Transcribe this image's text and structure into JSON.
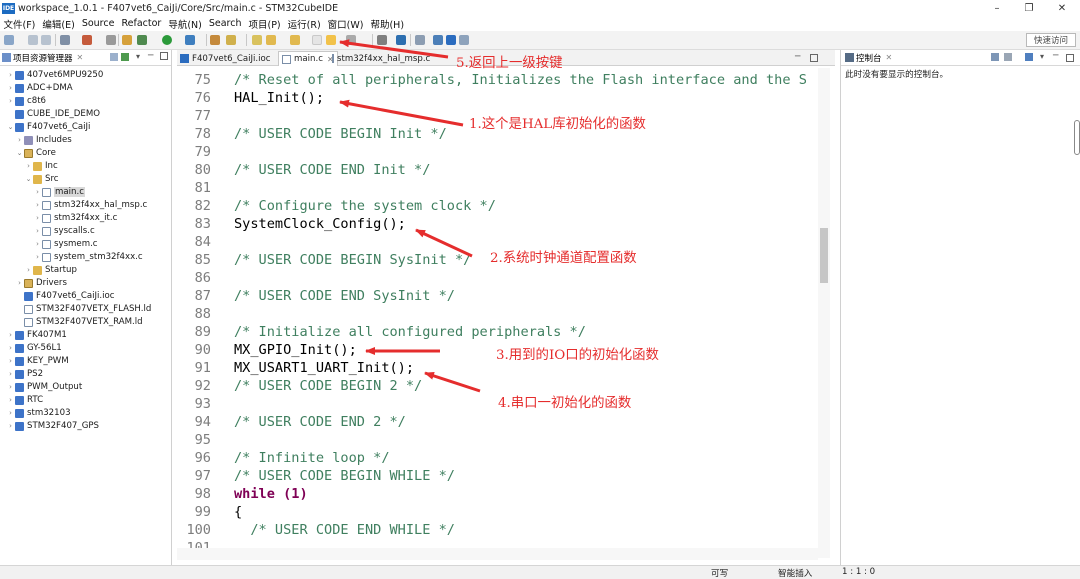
{
  "window": {
    "title": "workspace_1.0.1 - F407vet6_CaiJi/Core/Src/main.c - STM32CubeIDE",
    "app_icon": "IDE"
  },
  "menu": [
    "文件(F)",
    "编辑(E)",
    "Source",
    "Refactor",
    "导航(N)",
    "Search",
    "项目(P)",
    "运行(R)",
    "窗口(W)",
    "帮助(H)"
  ],
  "toolbar": {
    "quick_access": "快速访问"
  },
  "explorer": {
    "title": "项目资源管理器",
    "items": [
      {
        "label": "407vet6MPU9250"
      },
      {
        "label": "ADC+DMA"
      },
      {
        "label": "c8t6"
      },
      {
        "label": "CUBE_IDE_DEMO"
      },
      {
        "label": "F407vet6_CaiJi"
      },
      {
        "label": "Includes"
      },
      {
        "label": "Core"
      },
      {
        "label": "Inc"
      },
      {
        "label": "Src"
      },
      {
        "label": "main.c"
      },
      {
        "label": "stm32f4xx_hal_msp.c"
      },
      {
        "label": "stm32f4xx_it.c"
      },
      {
        "label": "syscalls.c"
      },
      {
        "label": "sysmem.c"
      },
      {
        "label": "system_stm32f4xx.c"
      },
      {
        "label": "Startup"
      },
      {
        "label": "Drivers"
      },
      {
        "label": "F407vet6_CaiJi.ioc"
      },
      {
        "label": "STM32F407VETX_FLASH.ld"
      },
      {
        "label": "STM32F407VETX_RAM.ld"
      },
      {
        "label": "FK407M1"
      },
      {
        "label": "GY-56L1"
      },
      {
        "label": "KEY_PWM"
      },
      {
        "label": "PS2"
      },
      {
        "label": "PWM_Output"
      },
      {
        "label": "RTC"
      },
      {
        "label": "stm32103"
      },
      {
        "label": "STM32F407_GPS"
      }
    ]
  },
  "editor": {
    "tabs": [
      {
        "label": "F407vet6_CaiJi.ioc"
      },
      {
        "label": "main.c"
      },
      {
        "label": "stm32f4xx_hal_msp.c"
      }
    ],
    "lines": [
      {
        "n": "75",
        "text": "/* Reset of all peripherals, Initializes the Flash interface and the S"
      },
      {
        "n": "76",
        "text": "HAL_Init();"
      },
      {
        "n": "77",
        "text": ""
      },
      {
        "n": "78",
        "text": "/* USER CODE BEGIN Init */"
      },
      {
        "n": "79",
        "text": ""
      },
      {
        "n": "80",
        "text": "/* USER CODE END Init */"
      },
      {
        "n": "81",
        "text": ""
      },
      {
        "n": "82",
        "text": "/* Configure the system clock */"
      },
      {
        "n": "83",
        "text": "SystemClock_Config();"
      },
      {
        "n": "84",
        "text": ""
      },
      {
        "n": "85",
        "text": "/* USER CODE BEGIN SysInit */"
      },
      {
        "n": "86",
        "text": ""
      },
      {
        "n": "87",
        "text": "/* USER CODE END SysInit */"
      },
      {
        "n": "88",
        "text": ""
      },
      {
        "n": "89",
        "text": "/* Initialize all configured peripherals */"
      },
      {
        "n": "90",
        "text": "MX_GPIO_Init();"
      },
      {
        "n": "91",
        "text": "MX_USART1_UART_Init();"
      },
      {
        "n": "92",
        "text": "/* USER CODE BEGIN 2 */"
      },
      {
        "n": "93",
        "text": ""
      },
      {
        "n": "94",
        "text": "/* USER CODE END 2 */"
      },
      {
        "n": "95",
        "text": ""
      },
      {
        "n": "96",
        "text": "/* Infinite loop */"
      },
      {
        "n": "97",
        "text": "/* USER CODE BEGIN WHILE */"
      },
      {
        "n": "98",
        "text": "while (1)"
      },
      {
        "n": "99",
        "text": "{"
      },
      {
        "n": "100",
        "text": "  /* USER CODE END WHILE */"
      },
      {
        "n": "101",
        "text": ""
      }
    ]
  },
  "console": {
    "title": "控制台",
    "message": "此时没有要显示的控制台。"
  },
  "status": {
    "writable": "可写",
    "insert_mode": "智能插入",
    "position": "1 : 1 : 0"
  },
  "annotations": [
    {
      "text": "1.这个是HAL库初始化的函数"
    },
    {
      "text": "2.系统时钟通道配置函数"
    },
    {
      "text": "3.用到的IO口的初始化函数"
    },
    {
      "text": "4.串口一初始化的函数"
    },
    {
      "text": "5.返回上一级按键"
    }
  ],
  "colors": {
    "annotation": "#e52d2d",
    "comment": "#3f7f5f",
    "keyword": "#7f0055",
    "line_number": "#7d7d7d"
  }
}
